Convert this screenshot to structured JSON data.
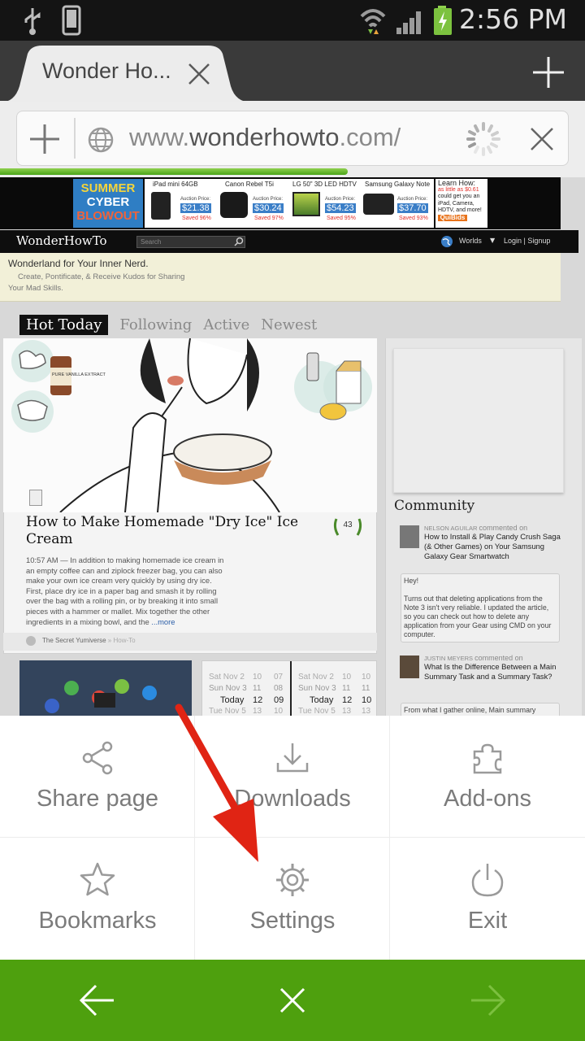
{
  "status_bar": {
    "time": "2:56 PM"
  },
  "browser": {
    "tab_title": "Wonder Ho...",
    "url_prefix": "www.",
    "url_domain": "wonderhowto",
    "url_suffix": ".com/",
    "load_progress": 0.6
  },
  "webpage": {
    "banner": {
      "promo": [
        "SUMMER",
        "CYBER",
        "BLOWOUT"
      ],
      "products": [
        {
          "name": "iPad mini 64GB",
          "label": "Auction Price:",
          "price": "$21.38",
          "saved": "Saved 96%"
        },
        {
          "name": "Canon Rebel T5i",
          "label": "Auction Price:",
          "price": "$30.24",
          "saved": "Saved 97%"
        },
        {
          "name": "LG 50\" 3D LED HDTV",
          "label": "Auction Price:",
          "price": "$54.23",
          "saved": "Saved 95%"
        },
        {
          "name": "Samsung Galaxy Note",
          "label": "Auction Price:",
          "price": "$37.70",
          "saved": "Saved 93%"
        }
      ],
      "learn": {
        "title": "Learn How:",
        "line1": "as little as $0.61",
        "line2": "could get you an",
        "line3": "iPad, Camera,",
        "line4": "HDTV, and more!",
        "brand": "QuiBids"
      }
    },
    "logo": "WonderHowTo",
    "search_placeholder": "Search",
    "worlds": "Worlds",
    "login": "Login | Signup",
    "tagline": "Wonderland for Your Inner Nerd.",
    "subtagline": "Create, Pontificate, & Receive Kudos for Sharing",
    "subtagline2": "Your Mad Skills.",
    "tabs": [
      "Hot Today",
      "Following",
      "Active",
      "Newest"
    ],
    "feature": {
      "title": "How to Make Homemade \"Dry Ice\" Ice Cream",
      "badge": "43",
      "bottle_label": "PURE VANILLA EXTRACT",
      "time": "10:57 AM",
      "body": "In addition to making homemade ice cream in an empty coffee can and ziplock freezer bag, you can also make your own ice cream very quickly by using dry ice. First, place dry ice in a paper bag and smash it by rolling over the bag with a rolling pin, or by breaking it into small pieces with a hammer or mallet. Mix together the other ingredients in a mixing bowl, and the",
      "more": "...more",
      "byline": "The Secret Yumiverse",
      "byline_suffix": "» How-To"
    },
    "community": {
      "title": "Community",
      "posts": [
        {
          "author": "NELSON AGUILAR",
          "action": "commented on",
          "title": "How to Install & Play Candy Crush Saga (& Other Games) on Your Samsung Galaxy Gear Smartwatch",
          "comment": "Hey!\n\nTurns out that deleting applications from the Note 3 isn't very reliable. I updated the article, so you can check out how to delete any application from your Gear using CMD on your computer."
        },
        {
          "author": "JUSTIN MEYERS",
          "action": "commented on",
          "title": "What Is the Difference Between a Main Summary Task and a Summary Task?",
          "comment": "From what I gather online, Main summary"
        }
      ]
    },
    "calendar": [
      [
        "Sat Nov 2",
        "10",
        "07"
      ],
      [
        "Sun Nov 3",
        "11",
        "08"
      ],
      [
        "Today",
        "12",
        "09"
      ],
      [
        "Tue Nov 5",
        "13",
        "10"
      ]
    ]
  },
  "menu": {
    "items": [
      {
        "label": "Share page",
        "icon": "share-icon"
      },
      {
        "label": "Downloads",
        "icon": "download-icon"
      },
      {
        "label": "Add-ons",
        "icon": "puzzle-icon"
      },
      {
        "label": "Bookmarks",
        "icon": "star-icon"
      },
      {
        "label": "Settings",
        "icon": "gear-icon"
      },
      {
        "label": "Exit",
        "icon": "power-icon"
      }
    ]
  },
  "colors": {
    "accent_green": "#4ea00e",
    "annotation_red": "#e02414"
  }
}
